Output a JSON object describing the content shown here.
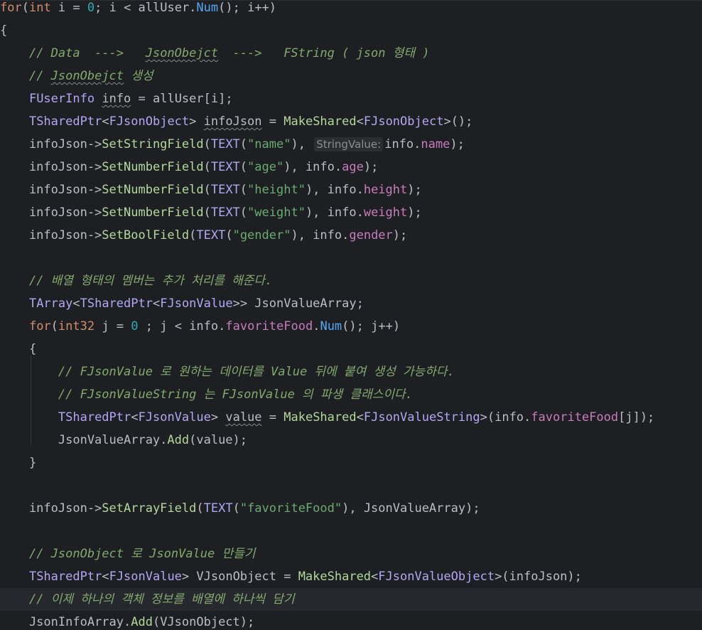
{
  "editor": {
    "language": "cpp",
    "colors": {
      "background": "#1e1f22",
      "current_line": "#26282e",
      "keyword": "#cf8e6d",
      "number": "#2aacb8",
      "type": "#b5a6f5",
      "function": "#56a8f5",
      "member": "#c77dbb",
      "string": "#6aab73",
      "comment": "#82aa6e"
    },
    "lines": [
      [
        [
          "kw",
          "for"
        ],
        [
          "plain",
          "("
        ],
        [
          "kw",
          "int"
        ],
        [
          "plain",
          " i = "
        ],
        [
          "num",
          "0"
        ],
        [
          "plain",
          "; i < allUser."
        ],
        [
          "fn",
          "Num"
        ],
        [
          "plain",
          "(); i++)"
        ]
      ],
      [
        [
          "plain",
          "{"
        ]
      ],
      [
        [
          "plain",
          "    "
        ],
        [
          "comment",
          "// Data  --->   "
        ],
        [
          "comment sq",
          "JsonObejct"
        ],
        [
          "comment",
          "  --->   FString ( json 형태 )"
        ]
      ],
      [
        [
          "plain",
          "    "
        ],
        [
          "comment",
          "// "
        ],
        [
          "comment sq",
          "JsonObejct"
        ],
        [
          "comment",
          " 생성"
        ]
      ],
      [
        [
          "plain",
          "    "
        ],
        [
          "type",
          "FUserInfo"
        ],
        [
          "plain",
          " "
        ],
        [
          "plain sq",
          "info"
        ],
        [
          "plain",
          " = allUser[i];"
        ]
      ],
      [
        [
          "plain",
          "    "
        ],
        [
          "type",
          "TSharedPtr"
        ],
        [
          "plain",
          "<"
        ],
        [
          "type",
          "FJsonObject"
        ],
        [
          "plain",
          "> "
        ],
        [
          "plain sq",
          "infoJson"
        ],
        [
          "plain",
          " = "
        ],
        [
          "green",
          "MakeShared"
        ],
        [
          "plain",
          "<"
        ],
        [
          "type",
          "FJsonObject"
        ],
        [
          "plain",
          ">();"
        ]
      ],
      [
        [
          "plain",
          "    infoJson->"
        ],
        [
          "green",
          "SetStringField"
        ],
        [
          "plain",
          "("
        ],
        [
          "type",
          "TEXT"
        ],
        [
          "plain",
          "("
        ],
        [
          "str",
          "\"name\""
        ],
        [
          "plain",
          "), "
        ],
        [
          "hint",
          "StringValue:"
        ],
        [
          "plain",
          "info."
        ],
        [
          "member",
          "name"
        ],
        [
          "plain",
          ");"
        ]
      ],
      [
        [
          "plain",
          "    infoJson->"
        ],
        [
          "green",
          "SetNumberField"
        ],
        [
          "plain",
          "("
        ],
        [
          "type",
          "TEXT"
        ],
        [
          "plain",
          "("
        ],
        [
          "str",
          "\"age\""
        ],
        [
          "plain",
          "), info."
        ],
        [
          "member",
          "age"
        ],
        [
          "plain",
          ");"
        ]
      ],
      [
        [
          "plain",
          "    infoJson->"
        ],
        [
          "green",
          "SetNumberField"
        ],
        [
          "plain",
          "("
        ],
        [
          "type",
          "TEXT"
        ],
        [
          "plain",
          "("
        ],
        [
          "str",
          "\"height\""
        ],
        [
          "plain",
          "), info."
        ],
        [
          "member",
          "height"
        ],
        [
          "plain",
          ");"
        ]
      ],
      [
        [
          "plain",
          "    infoJson->"
        ],
        [
          "green",
          "SetNumberField"
        ],
        [
          "plain",
          "("
        ],
        [
          "type",
          "TEXT"
        ],
        [
          "plain",
          "("
        ],
        [
          "str",
          "\"weight\""
        ],
        [
          "plain",
          "), info."
        ],
        [
          "member",
          "weight"
        ],
        [
          "plain",
          ");"
        ]
      ],
      [
        [
          "plain",
          "    infoJson->"
        ],
        [
          "green",
          "SetBoolField"
        ],
        [
          "plain",
          "("
        ],
        [
          "type",
          "TEXT"
        ],
        [
          "plain",
          "("
        ],
        [
          "str",
          "\"gender\""
        ],
        [
          "plain",
          "), info."
        ],
        [
          "member",
          "gender"
        ],
        [
          "plain",
          ");"
        ]
      ],
      [],
      [
        [
          "plain",
          "    "
        ],
        [
          "comment",
          "// 배열 형태의 멤버는 추가 처리를 해준다."
        ]
      ],
      [
        [
          "plain",
          "    "
        ],
        [
          "type",
          "TArray"
        ],
        [
          "plain",
          "<"
        ],
        [
          "type",
          "TSharedPtr"
        ],
        [
          "plain",
          "<"
        ],
        [
          "type",
          "FJsonValue"
        ],
        [
          "plain",
          ">> JsonValueArray;"
        ]
      ],
      [
        [
          "plain",
          "    "
        ],
        [
          "kw",
          "for"
        ],
        [
          "plain",
          "("
        ],
        [
          "kw",
          "int32"
        ],
        [
          "plain",
          " j = "
        ],
        [
          "num",
          "0"
        ],
        [
          "plain",
          " ; j < info."
        ],
        [
          "member",
          "favoriteFood"
        ],
        [
          "plain",
          "."
        ],
        [
          "fn",
          "Num"
        ],
        [
          "plain",
          "(); j++)"
        ]
      ],
      [
        [
          "plain",
          "    {"
        ]
      ],
      [
        [
          "plain",
          "        "
        ],
        [
          "comment",
          "// FJsonValue 로 원하는 데이터를 Value 뒤에 붙여 생성 가능하다."
        ]
      ],
      [
        [
          "plain",
          "        "
        ],
        [
          "comment",
          "// FJsonValueString 는 FJsonValue 의 파생 클래스이다."
        ]
      ],
      [
        [
          "plain",
          "        "
        ],
        [
          "type",
          "TSharedPtr"
        ],
        [
          "plain",
          "<"
        ],
        [
          "type",
          "FJsonValue"
        ],
        [
          "plain",
          "> "
        ],
        [
          "plain sq",
          "value"
        ],
        [
          "plain",
          " = "
        ],
        [
          "green",
          "MakeShared"
        ],
        [
          "plain",
          "<"
        ],
        [
          "type",
          "FJsonValueString"
        ],
        [
          "plain",
          ">(info."
        ],
        [
          "member",
          "favoriteFood"
        ],
        [
          "plain",
          "[j]);"
        ]
      ],
      [
        [
          "plain",
          "        JsonValueArray."
        ],
        [
          "green",
          "Add"
        ],
        [
          "plain",
          "(value);"
        ]
      ],
      [
        [
          "plain",
          "    }"
        ]
      ],
      [],
      [
        [
          "plain",
          "    infoJson->"
        ],
        [
          "green",
          "SetArrayField"
        ],
        [
          "plain",
          "("
        ],
        [
          "type",
          "TEXT"
        ],
        [
          "plain",
          "("
        ],
        [
          "str",
          "\"favoriteFood\""
        ],
        [
          "plain",
          "), JsonValueArray);"
        ]
      ],
      [],
      [
        [
          "plain",
          "    "
        ],
        [
          "comment",
          "// JsonObject 로 JsonValue 만들기"
        ]
      ],
      [
        [
          "plain",
          "    "
        ],
        [
          "type",
          "TSharedPtr"
        ],
        [
          "plain",
          "<"
        ],
        [
          "type",
          "FJsonValue"
        ],
        [
          "plain",
          "> VJsonObject = "
        ],
        [
          "green",
          "MakeShared"
        ],
        [
          "plain",
          "<"
        ],
        [
          "type",
          "FJsonValueObject"
        ],
        [
          "plain",
          ">(infoJson);"
        ]
      ],
      [
        [
          "plain",
          "    "
        ],
        [
          "comment",
          "// 이제 하나의 객체 정보를 배열에 하나씩 담기"
        ]
      ],
      [
        [
          "plain",
          "    JsonInfoArray."
        ],
        [
          "green",
          "Add"
        ],
        [
          "plain",
          "(VJsonObject);"
        ]
      ]
    ],
    "current_line_index": 26
  }
}
